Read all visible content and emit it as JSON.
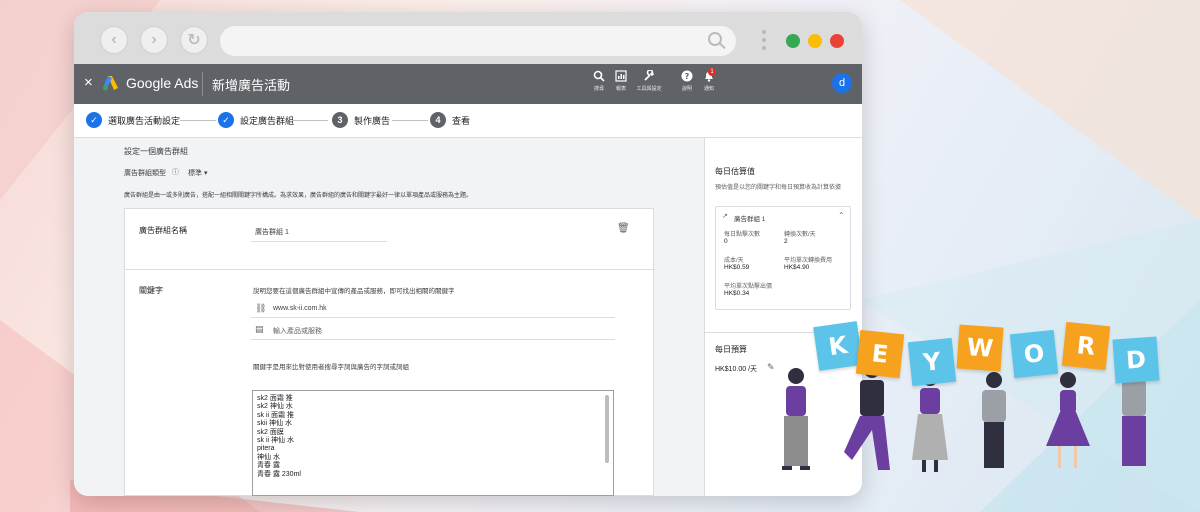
{
  "chrome": {
    "back_glyph": "‹",
    "forward_glyph": "›",
    "reload_glyph": "↻",
    "dots": [
      "#34a853",
      "#fbbc04",
      "#ea4335"
    ]
  },
  "adsbar": {
    "close": "×",
    "brand": "Google Ads",
    "title": "新增廣告活動",
    "tools": [
      {
        "icon": "search-icon",
        "glyph": "🔍",
        "label": "搜尋"
      },
      {
        "icon": "report-icon",
        "glyph": "▥",
        "label": "報表"
      },
      {
        "icon": "wrench-icon",
        "glyph": "🔧",
        "label": "工具與設定"
      },
      {
        "icon": "help-icon",
        "glyph": "?",
        "label": "說明"
      },
      {
        "icon": "bell-icon",
        "glyph": "🔔",
        "label": "通知"
      }
    ],
    "notification_count": "1",
    "avatar_letter": "d"
  },
  "steps": [
    {
      "label": "選取廣告活動設定",
      "state": "done"
    },
    {
      "label": "設定廣告群組",
      "state": "done"
    },
    {
      "label": "製作廣告",
      "state": "3"
    },
    {
      "label": "查看",
      "state": "4"
    }
  ],
  "main": {
    "heading": "設定一個廣告群組",
    "type_label": "廣告群組類型",
    "type_value": "標準",
    "description": "廣告群組是由一或多則廣告，搭配一組相關關鍵字所構成。為求效果，廣告群組的廣告和關鍵字最好一律以單項產品或服務為主題。",
    "ad_group_name_label": "廣告群組名稱",
    "ad_group_name_value": "廣告群組 1",
    "keywords_label": "關鍵字",
    "keywords_hint": "說明您要在這個廣告群組中宣傳的產品或服務，即可找出相關的關鍵字",
    "website": "www.sk-ii.com.hk",
    "product_placeholder": "輸入產品或服務",
    "keywords_box_hint": "關鍵字是用來比對使用者搜尋字詞與廣告的字詞或詞組",
    "keywords": [
      "sk2 面霜 推",
      "sk2 神仙 水",
      "sk ii 面霜 推",
      "skii 神仙 水",
      "sk2 面膜",
      "sk ii 神仙 水",
      "pitera",
      "神仙 水",
      "青春 露",
      "青春 露 230ml"
    ]
  },
  "side": {
    "title": "每日估算值",
    "desc": "預估值是以您的關鍵字和每日預算收為計算依據",
    "group_name": "廣告群組 1",
    "stats": [
      {
        "label": "每日點擊次數",
        "value": "0"
      },
      {
        "label": "轉換次數/天",
        "value": "2"
      },
      {
        "label": "成本/天",
        "value": "HK$0.59"
      },
      {
        "label": "平均單次轉換費用",
        "value": "HK$4.90"
      },
      {
        "label": "平均單次點擊出價",
        "value": "HK$0.34"
      }
    ],
    "budget_title": "每日預算",
    "budget_value": "HK$10.00 /天"
  },
  "illustration": {
    "letters": [
      "K",
      "E",
      "Y",
      "W",
      "O",
      "R",
      "D"
    ],
    "colors": {
      "blue": "#5bc4e8",
      "orange": "#f6a21e",
      "purple": "#6b3fa0",
      "dark": "#2f2f3f"
    }
  }
}
